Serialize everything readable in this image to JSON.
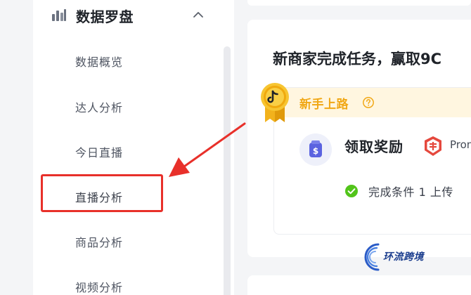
{
  "sidebar": {
    "group": {
      "title": "数据罗盘",
      "icon": "bar-chart-icon",
      "expanded": true
    },
    "items": [
      {
        "label": "数据概览"
      },
      {
        "label": "达人分析"
      },
      {
        "label": "今日直播"
      },
      {
        "label": "直播分析",
        "highlighted": true
      },
      {
        "label": "商品分析"
      },
      {
        "label": "视频分析"
      }
    ]
  },
  "main": {
    "title": "新商家完成任务，赢取9C",
    "task": {
      "band_title": "新手上路",
      "reward_title": "领取奖励",
      "promo_label": "Pron",
      "condition_text": "完成条件 1  上传"
    }
  },
  "annotation": {
    "highlight_color": "#e8302a"
  },
  "watermark": {
    "text": "环流跨境"
  },
  "colors": {
    "accent_orange": "#f1a816",
    "band_background": "#fff6e0",
    "success_green": "#52c41a",
    "reward_blue": "#5b63e0",
    "promo_red": "#e5483d"
  }
}
